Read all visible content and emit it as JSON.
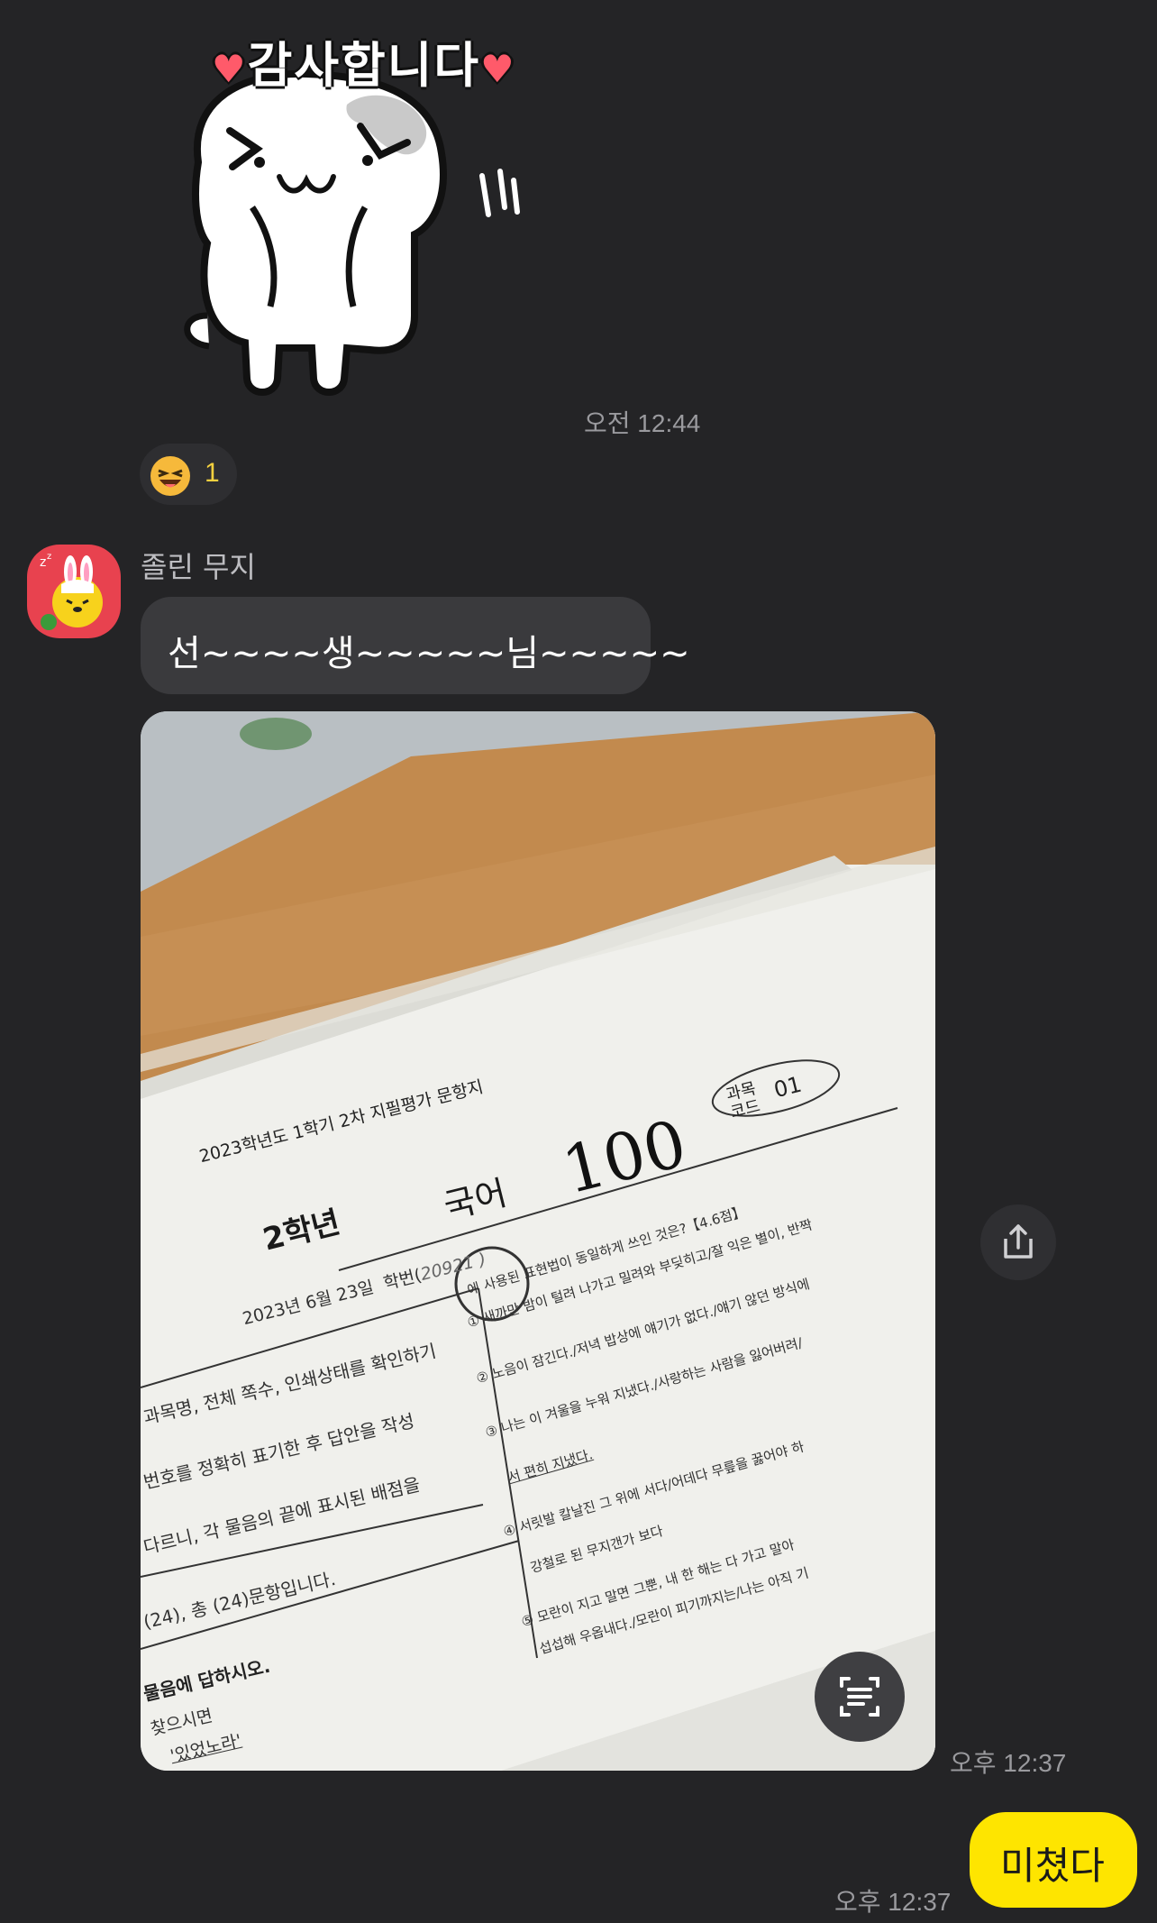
{
  "chat": {
    "sticker": {
      "text": "감사합니다",
      "heart_left": "♥",
      "heart_right": "♥",
      "time": "오전 12:44"
    },
    "reaction": {
      "emoji": "laughing-face-icon",
      "count": "1"
    },
    "incoming": {
      "sender": "졸린 무지",
      "message": "선~~~~생~~~~~님~~~~~",
      "photo_time": "오후 12:37",
      "photo": {
        "paper_title": "2023학년도 1학기 2차 지필평가 문항지",
        "grade": "2학년",
        "subject": "국어",
        "score": "100",
        "code_label_1": "과목",
        "code_label_2": "코드",
        "code_value": "01",
        "date_line": "2023년 6월 23일",
        "student_no_label": "학번(",
        "student_no": "20921 )",
        "box_line_1": "과목명, 전체 쪽수, 인쇄상태를 확인하기",
        "box_line_2": "번호를 정확히 표기한 후 답안을 작성",
        "box_line_3": "다르니, 각 물음의 끝에 표시된 배점을",
        "box_line_4": "(24), 총 (24)문항입니다.",
        "box_line_5": "물음에 답하시오.",
        "box_line_6": "찾으시면",
        "box_line_7": "'있었노라'",
        "q_line_1": "에 사용된 표현법이 동일하게 쓰인 것은?【4.6점】",
        "q_line_2": "① 새까만 밤이 털려 나가고 밀려와 부딪히고/잘 익은 별이, 반짝",
        "q_line_3": "② 노음이 잠긴다./저녁 밥상에 얘기가 없다./얘기 않던 방식에 ",
        "q_line_4": "③ 나는 이 겨울을 누워 지냈다./사랑하는 사람을 잃어버려/",
        "q_line_5": "서 편히 지냈다.",
        "q_line_6": "④ 서릿발 칼날진 그 위에 서다/어데다 무릎을 꿇어야 하",
        "q_line_7": "강철로 된 무지갠가 보다",
        "q_line_8": "⑤ 모란이 지고 말면 그뿐, 내 한 해는 다 가고 말아",
        "q_line_9": "섭섭해 우옵내다./모란이 피기까지는/나는 아직 기"
      }
    },
    "outgoing": {
      "message": "미쳤다",
      "time": "오후 12:37"
    },
    "colors": {
      "background": "#242426",
      "incoming_bubble": "#3a3a3d",
      "outgoing_bubble": "#fee500",
      "timestamp": "#9a9a9e",
      "reaction_count": "#f4d03f"
    }
  }
}
